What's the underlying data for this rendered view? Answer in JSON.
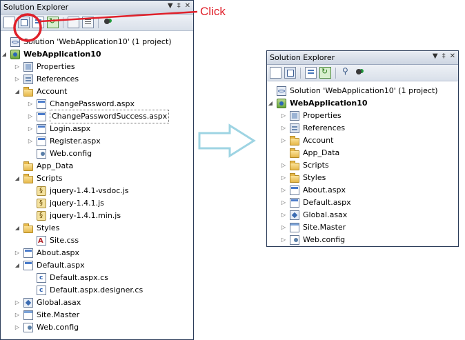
{
  "annotation": {
    "text": "Click",
    "color": "#e0202a"
  },
  "left_panel": {
    "title": "Solution Explorer",
    "controls": [
      "▼",
      "‡",
      "✕"
    ],
    "tree": [
      {
        "label": "Solution 'WebApplication10' (1 project)",
        "icon": "solution",
        "level": 0,
        "expander": ""
      },
      {
        "label": "WebApplication10",
        "icon": "project",
        "level": 0,
        "expander": "◢",
        "bold": true
      },
      {
        "label": "Properties",
        "icon": "props",
        "level": 1,
        "expander": "▷"
      },
      {
        "label": "References",
        "icon": "refs",
        "level": 1,
        "expander": "▷"
      },
      {
        "label": "Account",
        "icon": "folder",
        "level": 1,
        "expander": "◢"
      },
      {
        "label": "ChangePassword.aspx",
        "icon": "aspx",
        "level": 2,
        "expander": "▷"
      },
      {
        "label": "ChangePasswordSuccess.aspx",
        "icon": "aspx",
        "level": 2,
        "expander": "▷",
        "selected": true
      },
      {
        "label": "Login.aspx",
        "icon": "aspx",
        "level": 2,
        "expander": "▷"
      },
      {
        "label": "Register.aspx",
        "icon": "aspx",
        "level": 2,
        "expander": "▷"
      },
      {
        "label": "Web.config",
        "icon": "config",
        "level": 2,
        "expander": ""
      },
      {
        "label": "App_Data",
        "icon": "folder",
        "level": 1,
        "expander": ""
      },
      {
        "label": "Scripts",
        "icon": "folder",
        "level": 1,
        "expander": "◢"
      },
      {
        "label": "jquery-1.4.1-vsdoc.js",
        "icon": "js",
        "level": 2,
        "expander": ""
      },
      {
        "label": "jquery-1.4.1.js",
        "icon": "js",
        "level": 2,
        "expander": ""
      },
      {
        "label": "jquery-1.4.1.min.js",
        "icon": "js",
        "level": 2,
        "expander": ""
      },
      {
        "label": "Styles",
        "icon": "folder",
        "level": 1,
        "expander": "◢"
      },
      {
        "label": "Site.css",
        "icon": "css",
        "level": 2,
        "expander": ""
      },
      {
        "label": "About.aspx",
        "icon": "aspx",
        "level": 1,
        "expander": "▷"
      },
      {
        "label": "Default.aspx",
        "icon": "aspx",
        "level": 1,
        "expander": "◢"
      },
      {
        "label": "Default.aspx.cs",
        "icon": "cs",
        "level": 2,
        "expander": ""
      },
      {
        "label": "Default.aspx.designer.cs",
        "icon": "cs",
        "level": 2,
        "expander": ""
      },
      {
        "label": "Global.asax",
        "icon": "asax",
        "level": 1,
        "expander": "▷"
      },
      {
        "label": "Site.Master",
        "icon": "master",
        "level": 1,
        "expander": "▷"
      },
      {
        "label": "Web.config",
        "icon": "config",
        "level": 1,
        "expander": "▷"
      }
    ]
  },
  "right_panel": {
    "title": "Solution Explorer",
    "controls": [
      "▼",
      "‡",
      "✕"
    ],
    "tree": [
      {
        "label": "Solution 'WebApplication10' (1 project)",
        "icon": "solution",
        "level": 0,
        "expander": ""
      },
      {
        "label": "WebApplication10",
        "icon": "project",
        "level": 0,
        "expander": "◢",
        "bold": true
      },
      {
        "label": "Properties",
        "icon": "props",
        "level": 1,
        "expander": "▷"
      },
      {
        "label": "References",
        "icon": "refs",
        "level": 1,
        "expander": "▷"
      },
      {
        "label": "Account",
        "icon": "folder",
        "level": 1,
        "expander": "▷"
      },
      {
        "label": "App_Data",
        "icon": "folder",
        "level": 1,
        "expander": ""
      },
      {
        "label": "Scripts",
        "icon": "folder",
        "level": 1,
        "expander": "▷"
      },
      {
        "label": "Styles",
        "icon": "folder",
        "level": 1,
        "expander": "▷"
      },
      {
        "label": "About.aspx",
        "icon": "aspx",
        "level": 1,
        "expander": "▷"
      },
      {
        "label": "Default.aspx",
        "icon": "aspx",
        "level": 1,
        "expander": "▷"
      },
      {
        "label": "Global.asax",
        "icon": "asax",
        "level": 1,
        "expander": "▷"
      },
      {
        "label": "Site.Master",
        "icon": "master",
        "level": 1,
        "expander": "▷"
      },
      {
        "label": "Web.config",
        "icon": "config",
        "level": 1,
        "expander": "▷"
      }
    ]
  }
}
